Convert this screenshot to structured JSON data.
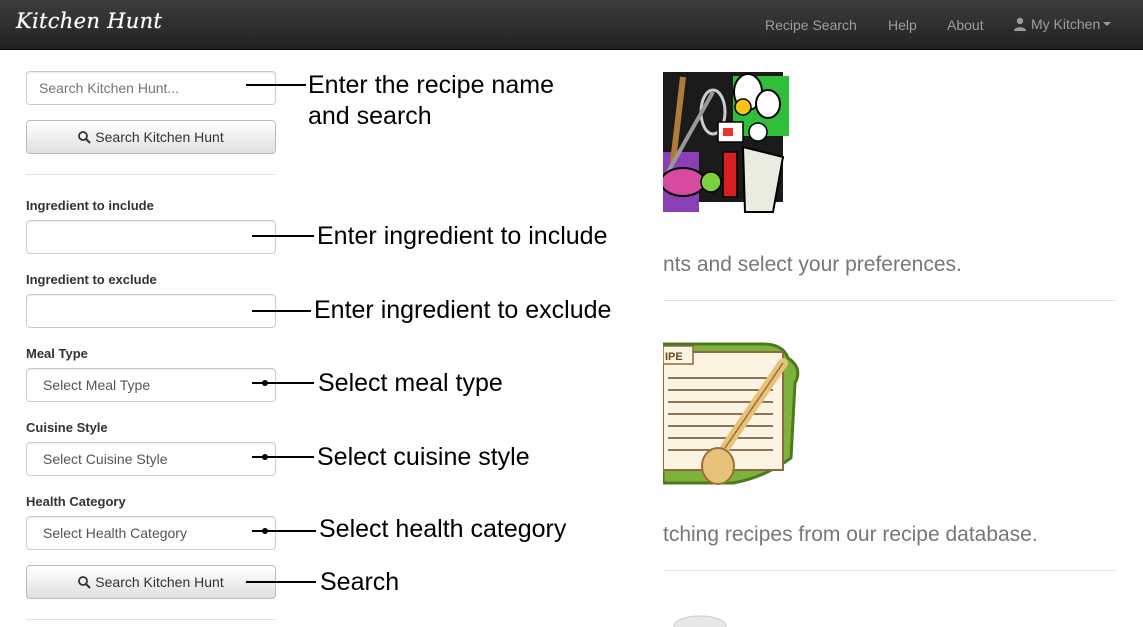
{
  "navbar": {
    "brand": "Kitchen Hunt",
    "links": [
      "Recipe Search",
      "Help",
      "About"
    ],
    "user_menu": "My Kitchen"
  },
  "search": {
    "placeholder": "Search Kitchen Hunt...",
    "button_label": "Search Kitchen Hunt"
  },
  "filters": {
    "include_label": "Ingredient to include",
    "exclude_label": "Ingredient to exclude",
    "meal_type_label": "Meal Type",
    "meal_type_value": "Select Meal Type",
    "cuisine_label": "Cuisine Style",
    "cuisine_value": "Select Cuisine Style",
    "health_label": "Health Category",
    "health_value": "Select Health Category",
    "search_button": "Search Kitchen Hunt"
  },
  "annotations": {
    "recipe_name_line1": "Enter the recipe name",
    "recipe_name_line2": "and search",
    "include": "Enter ingredient to include",
    "exclude": "Enter ingredient to exclude",
    "meal_type": "Select meal type",
    "cuisine": "Select cuisine style",
    "health": "Select health category",
    "search": "Search"
  },
  "content": {
    "step1_text": "nts and select your preferences.",
    "step2_text": "tching recipes from our recipe database.",
    "recipe_card_tab": "IPE"
  }
}
